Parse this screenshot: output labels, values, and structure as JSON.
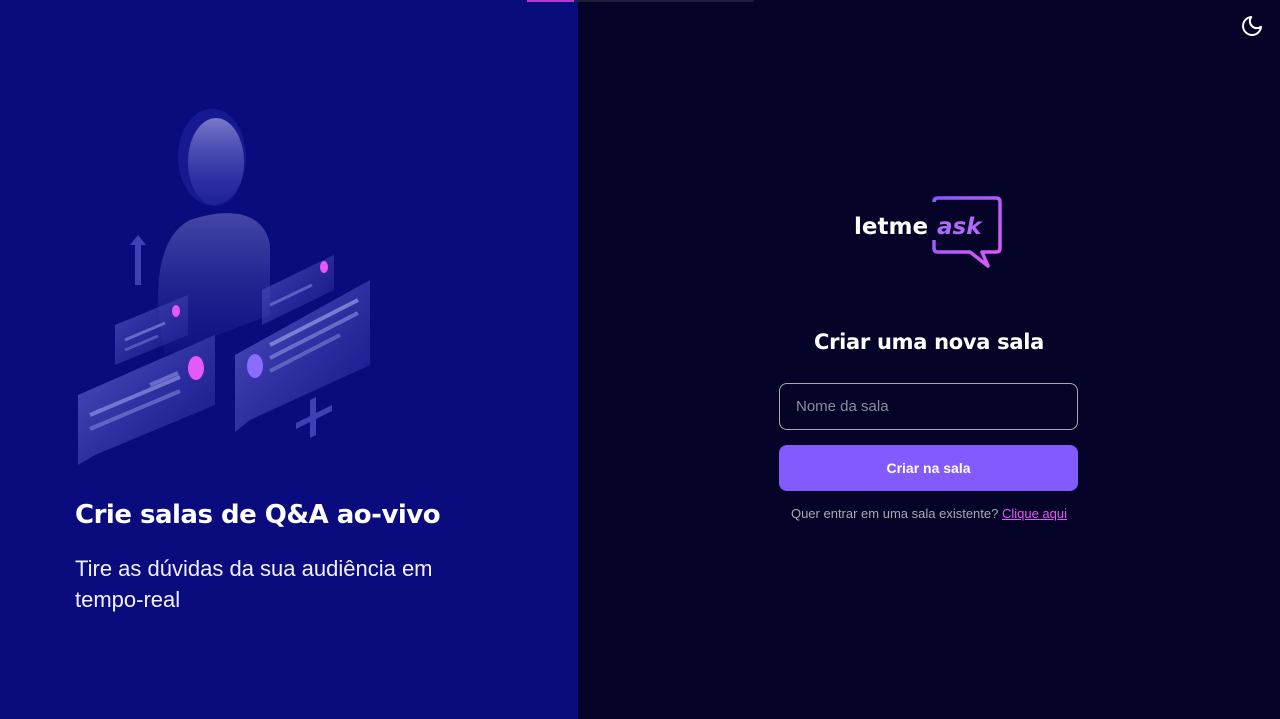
{
  "colors": {
    "aside_bg": "#0a0b7d",
    "main_bg": "#050327",
    "accent_purple": "#835afd",
    "accent_pink": "#e559f9"
  },
  "aside": {
    "title": "Crie salas de Q&A ao-vivo",
    "subtitle": "Tire as dúvidas da sua audiência em tempo-real",
    "illustration_icon": "people-qa-illustration-icon"
  },
  "header": {
    "theme_toggle_icon": "moon-icon"
  },
  "logo": {
    "text_main": "letme",
    "text_accent": "ask"
  },
  "form": {
    "title": "Criar uma nova sala",
    "input_placeholder": "Nome da sala",
    "input_value": "",
    "submit_label": "Criar na sala",
    "join_prompt": "Quer entrar em uma sala existente? ",
    "join_link": "Clique aqui"
  }
}
